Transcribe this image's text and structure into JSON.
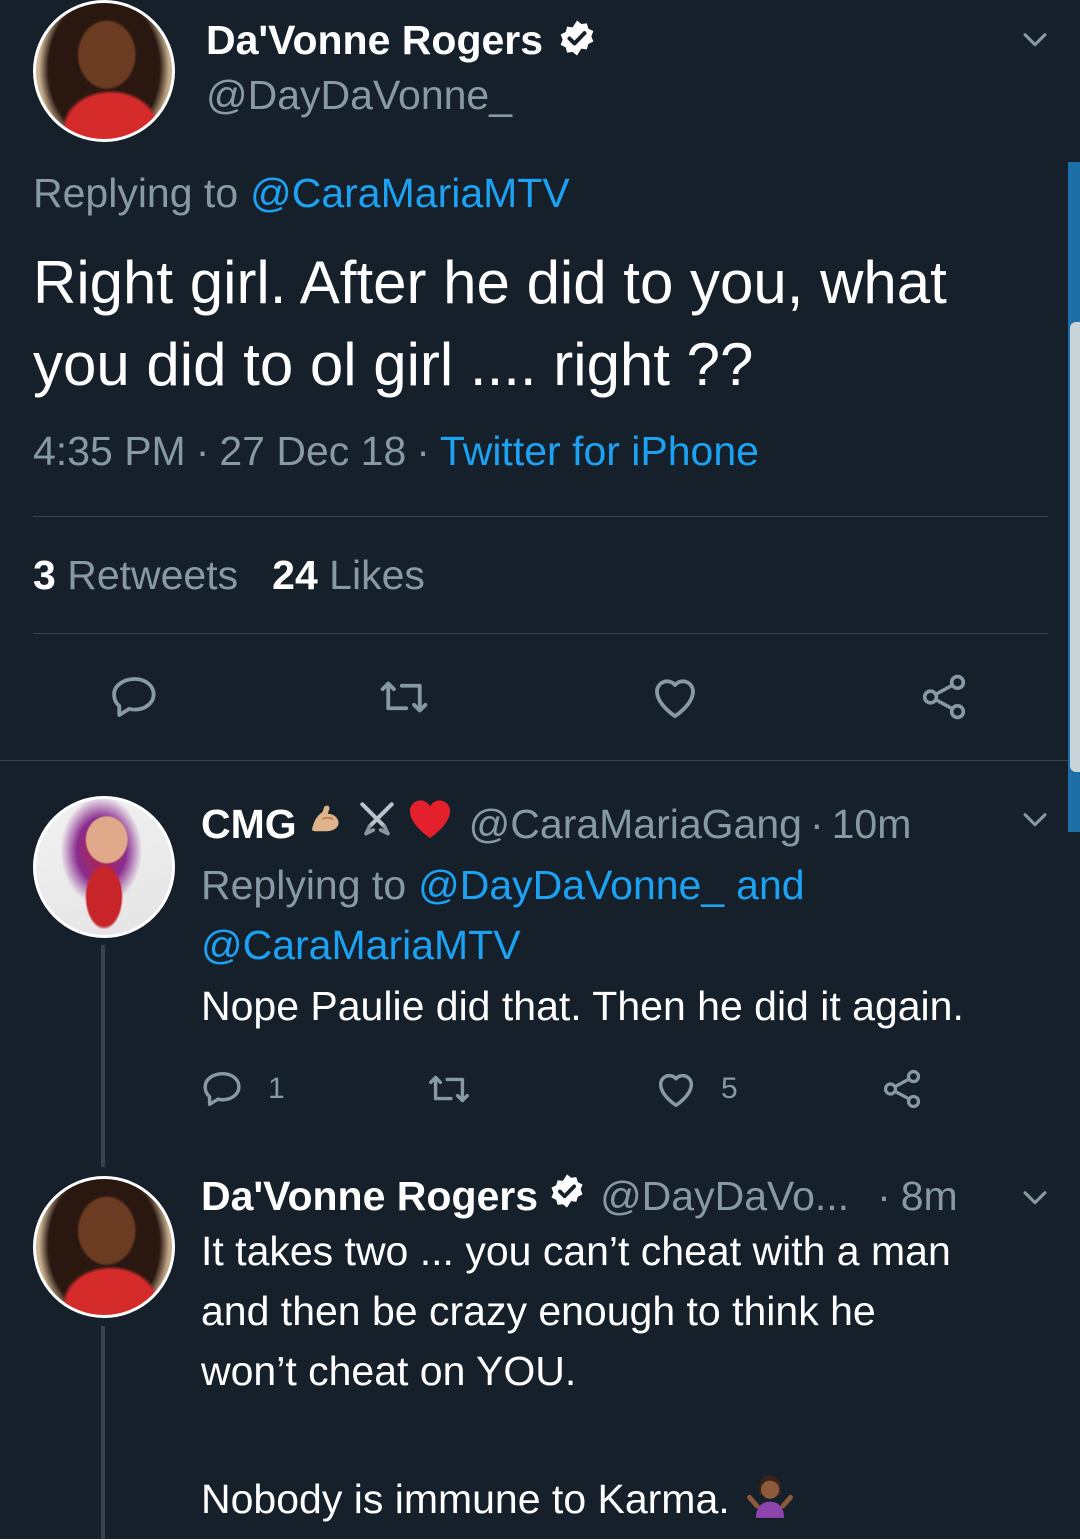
{
  "main_tweet": {
    "author_name": "Da'Vonne Rogers",
    "handle": "@DayDaVonne_",
    "replying_prefix": "Replying to",
    "replying_to": "@CaraMariaMTV",
    "text_line1": "Right girl. After he did to you, what",
    "text_line2": "you did to ol girl .... right ??",
    "time": "4:35 PM",
    "date": "27 Dec 18",
    "source": "Twitter for iPhone",
    "retweets_count": "3",
    "retweets_label": "Retweets",
    "likes_count": "24",
    "likes_label": "Likes"
  },
  "reply1": {
    "author_name": "CMG",
    "handle": "@CaraMariaGang",
    "time": "10m",
    "replying_prefix": "Replying to",
    "replying_to_1": "@DayDaVonne_",
    "replying_joiner": "and",
    "replying_to_2": "@CaraMariaMTV",
    "text": "Nope Paulie did that. Then he did it again.",
    "reply_count": "1",
    "like_count": "5"
  },
  "reply2": {
    "author_name": "Da'Vonne Rogers",
    "handle": "@DayDaVo...",
    "time": "8m",
    "text_line1": "It takes two ... you can’t cheat with a man",
    "text_line2": "and then be crazy enough to think he",
    "text_line3": "won’t cheat on YOU.",
    "text_line4": "Nobody is immune to Karma."
  },
  "separator": "·",
  "icons": {
    "verified": "verified-badge-icon",
    "reply": "reply-icon",
    "retweet": "retweet-icon",
    "like": "heart-icon",
    "share": "share-icon",
    "more": "chevron-down-icon"
  },
  "colors": {
    "background": "#15202b",
    "accent": "#1da1f2",
    "muted": "#8899a6",
    "divider": "#38444d"
  }
}
